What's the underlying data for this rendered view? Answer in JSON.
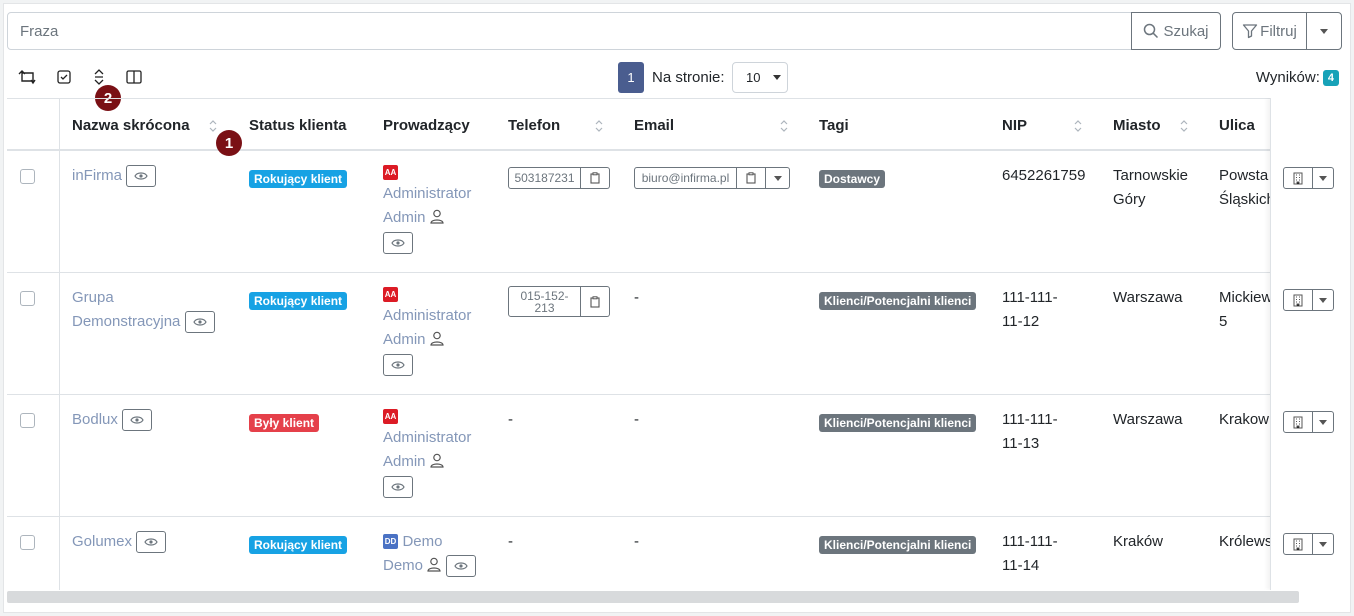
{
  "search": {
    "placeholder": "Fraza",
    "value": "",
    "button_label": "Szukaj"
  },
  "filter": {
    "button_label": "Filtruj"
  },
  "toolbar": {
    "icons": [
      "swap-icon",
      "checkbox-icon",
      "sort-icon",
      "columns-icon"
    ],
    "marker_2": "2"
  },
  "pagination": {
    "current_page": "1",
    "per_page_label": "Na stronie:",
    "per_page_value": "10"
  },
  "results": {
    "label": "Wyników:",
    "count": "4"
  },
  "table": {
    "marker_1": "1",
    "headers": {
      "name": "Nazwa skrócona",
      "status": "Status klienta",
      "owner": "Prowadzący",
      "phone": "Telefon",
      "email": "Email",
      "tags": "Tagi",
      "nip": "NIP",
      "city": "Miasto",
      "street": "Ulica"
    },
    "rows": [
      {
        "name": "inFirma",
        "status": "Rokujący klient",
        "owner_initials": "AA",
        "owner_line1": "Administrator",
        "owner_line2": "Admin",
        "phone": "503187231",
        "email": "biuro@infirma.pl",
        "tag": "Dostawcy",
        "nip_line1": "6452261759",
        "nip_line2": "",
        "city_line1": "Tarnowskie",
        "city_line2": "Góry",
        "street_line1": "Powsta",
        "street_line2": "Śląskich"
      },
      {
        "name_line1": "Grupa",
        "name_line2": "Demonstracyjna",
        "status": "Rokujący klient",
        "owner_initials": "AA",
        "owner_line1": "Administrator",
        "owner_line2": "Admin",
        "phone_line1": "015-152-",
        "phone_line2": "213",
        "email": "-",
        "tag": "Klienci/Potencjalni klienci",
        "nip_line1": "111-111-",
        "nip_line2": "11-12",
        "city_line1": "Warszawa",
        "street_line1": "Mickiew",
        "street_line2": "5"
      },
      {
        "name": "Bodlux",
        "status": "Były klient",
        "owner_initials": "AA",
        "owner_line1": "Administrator",
        "owner_line2": "Admin",
        "phone": "-",
        "email": "-",
        "tag": "Klienci/Potencjalni klienci",
        "nip_line1": "111-111-",
        "nip_line2": "11-13",
        "city_line1": "Warszawa",
        "street_line1": "Krakow"
      },
      {
        "name": "Golumex",
        "status": "Rokujący klient",
        "owner_initials": "DD",
        "owner_line1": "Demo",
        "owner_line2": "Demo",
        "phone": "-",
        "email": "-",
        "tag": "Klienci/Potencjalni klienci",
        "nip_line1": "111-111-",
        "nip_line2": "11-14",
        "city_line1": "Kraków",
        "street_line1": "Królews"
      }
    ]
  },
  "colors": {
    "info": "#17a2e4",
    "danger": "#e5404a",
    "tag_gray": "#6c757d",
    "page_active": "#4a5d8f",
    "marker": "#7a1015",
    "link": "#8497b8"
  }
}
